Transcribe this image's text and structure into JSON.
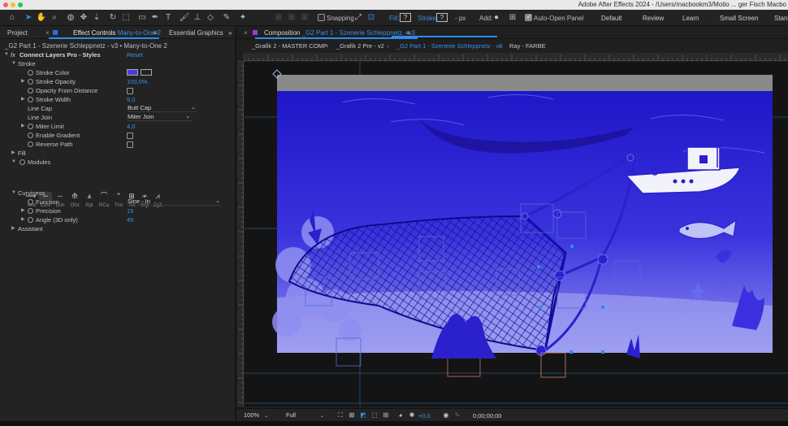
{
  "window": {
    "title": "Adobe After Effects 2024 - /Users/macbookm3/Motio ... ger Fisch Macbo"
  },
  "toolbar": {
    "snapping_label": "Snapping",
    "fill_label": "Fill:",
    "stroke_label": "Stroke:",
    "stroke_unit": "- px",
    "add_label": "Add:",
    "auto_open_label": "Auto-Open Panel",
    "workspaces": [
      "Default",
      "Review",
      "Learn",
      "Small Screen",
      "Stand"
    ]
  },
  "left_panel": {
    "tabs": {
      "project": "Project",
      "effect_controls": "Effect Controls",
      "effect_controls_layer": "Many-to-One 2",
      "essential_graphics": "Essential Graphics"
    },
    "breadcrumb": "_G2 Part 1 - Szenerie Schleppnetz - v3 • Many-to-One 2",
    "effect": {
      "fx_label": "fx",
      "name": "Connect Layers Pro - Styles",
      "reset": "Reset"
    },
    "stroke_group": "Stroke",
    "stroke_color": "Stroke Color",
    "stroke_opacity": {
      "label": "Stroke Opacity",
      "value": "100,0%"
    },
    "opacity_from_distance": "Opacity From Distance",
    "stroke_width": {
      "label": "Stroke Width",
      "value": "9,0"
    },
    "line_cap": {
      "label": "Line Cap",
      "value": "Butt Cap"
    },
    "line_join": {
      "label": "Line Join",
      "value": "Miter Join"
    },
    "miter_limit": {
      "label": "Miter Limit",
      "value": "4,0"
    },
    "enable_gradient": "Enable Gradient",
    "reverse_path": "Reverse Path",
    "fill_group": "Fill",
    "modules_group": "Modules",
    "modules": [
      "Arw",
      "Curv",
      "Dsh",
      "Ofst",
      "Rpt",
      "RCa",
      "Trm",
      "Twt",
      "Wgl",
      "ZgZ"
    ],
    "curviness_group": "Curviness",
    "function": {
      "label": "Function",
      "value": "Sine - In"
    },
    "precision": {
      "label": "Precision",
      "value": "15"
    },
    "angle": {
      "label": "Angle (3D only)",
      "value": "45"
    },
    "assistant_group": "Assistant"
  },
  "composition": {
    "panel_label": "Composition",
    "comp_name": "_G2 Part 1 - Szenerie Schleppnetz - v3",
    "subtabs": [
      "_Grafik 2 - MASTER COMP",
      "_Grafik 2 Pre - v2",
      "_G2 Part 1 - Szenerie Schleppnetz - v3",
      "Ray - FARBE"
    ],
    "footer": {
      "zoom": "100%",
      "resolution": "Full",
      "exposure": "+0,0",
      "timecode": "0;00;00;00"
    }
  },
  "colors": {
    "accent": "#2d8ceb",
    "value_blue": "#3b8fe8",
    "stroke_color": "#4a3ce0",
    "scene_bg": "#2a1fd6"
  }
}
